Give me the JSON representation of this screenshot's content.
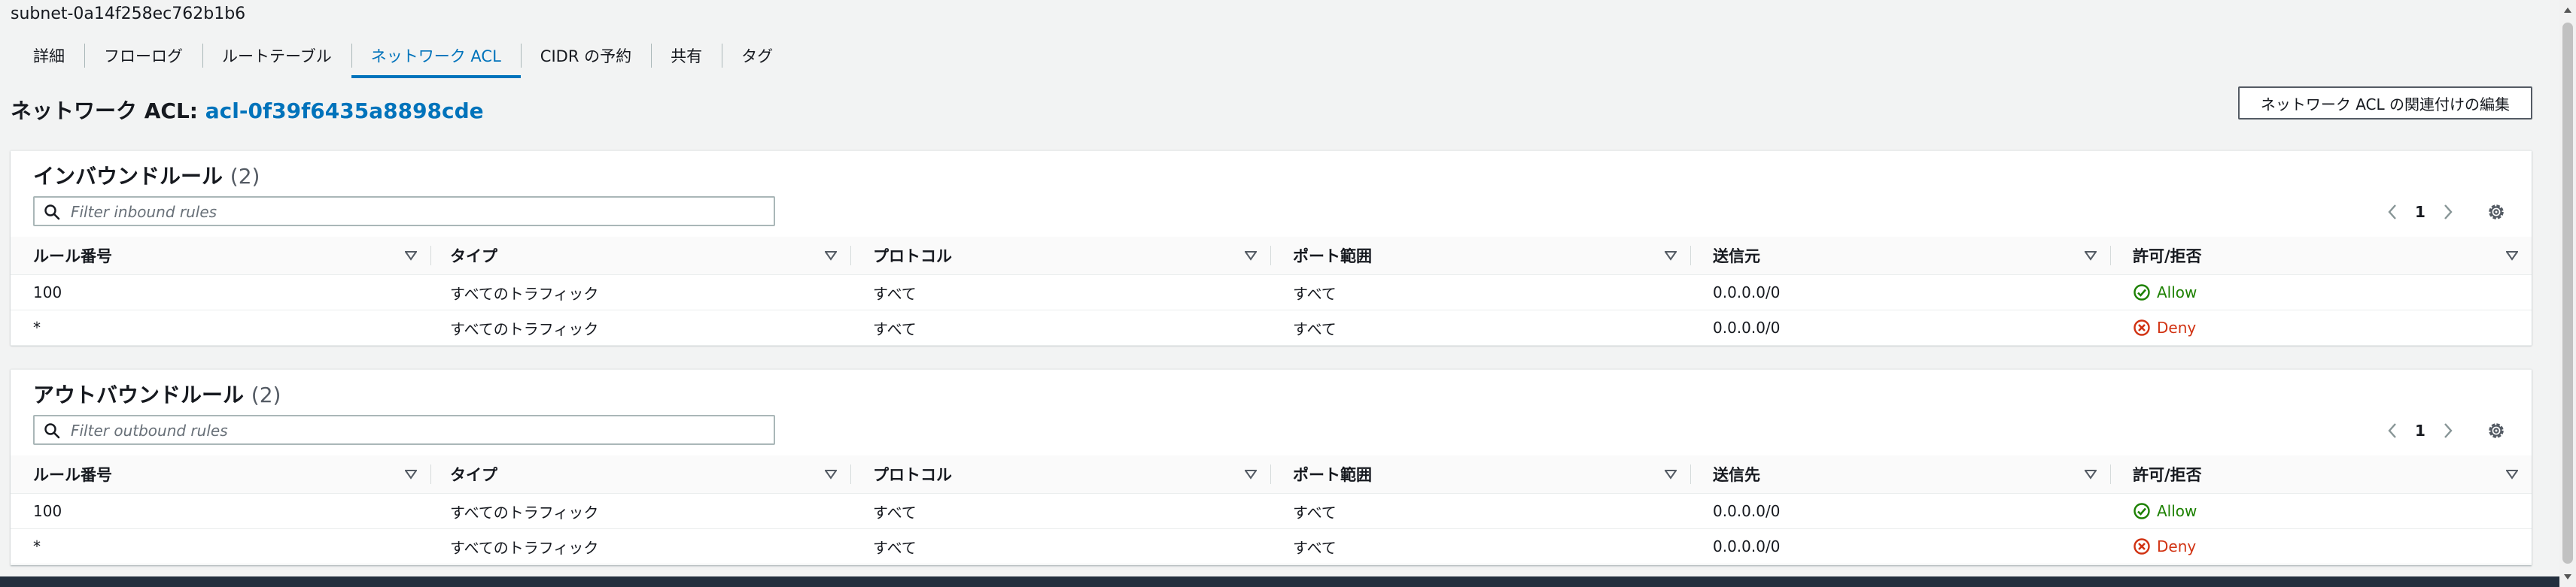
{
  "subnet_title": "subnet-0a14f258ec762b1b6",
  "tabs": [
    {
      "label": "詳細",
      "active": false
    },
    {
      "label": "フローログ",
      "active": false
    },
    {
      "label": "ルートテーブル",
      "active": false
    },
    {
      "label": "ネットワーク ACL",
      "active": true
    },
    {
      "label": "CIDR の予約",
      "active": false
    },
    {
      "label": "共有",
      "active": false
    },
    {
      "label": "タグ",
      "active": false
    }
  ],
  "acl": {
    "label": "ネットワーク ACL:",
    "id": "acl-0f39f6435a8898cde",
    "edit_button": "ネットワーク ACL の関連付けの編集"
  },
  "inbound": {
    "title": "インバウンドルール",
    "count": "(2)",
    "filter_placeholder": "Filter inbound rules",
    "page": "1",
    "columns": [
      "ルール番号",
      "タイプ",
      "プロトコル",
      "ポート範囲",
      "送信元",
      "許可/拒否"
    ],
    "rows": [
      {
        "rule": "100",
        "type": "すべてのトラフィック",
        "protocol": "すべて",
        "port": "すべて",
        "cidr": "0.0.0.0/0",
        "action": "Allow"
      },
      {
        "rule": "*",
        "type": "すべてのトラフィック",
        "protocol": "すべて",
        "port": "すべて",
        "cidr": "0.0.0.0/0",
        "action": "Deny"
      }
    ]
  },
  "outbound": {
    "title": "アウトバウンドルール",
    "count": "(2)",
    "filter_placeholder": "Filter outbound rules",
    "page": "1",
    "columns": [
      "ルール番号",
      "タイプ",
      "プロトコル",
      "ポート範囲",
      "送信先",
      "許可/拒否"
    ],
    "rows": [
      {
        "rule": "100",
        "type": "すべてのトラフィック",
        "protocol": "すべて",
        "port": "すべて",
        "cidr": "0.0.0.0/0",
        "action": "Allow"
      },
      {
        "rule": "*",
        "type": "すべてのトラフィック",
        "protocol": "すべて",
        "port": "すべて",
        "cidr": "0.0.0.0/0",
        "action": "Deny"
      }
    ]
  },
  "colors": {
    "link": "#0073bb",
    "allow": "#1d8102",
    "deny": "#d13212",
    "background": "#f2f3f3"
  },
  "icons": {
    "search": "search-icon",
    "sort": "sort-caret-icon",
    "settings": "gear-icon",
    "prev": "chevron-left-icon",
    "next": "chevron-right-icon",
    "allow": "check-circle-icon",
    "deny": "x-circle-icon"
  }
}
